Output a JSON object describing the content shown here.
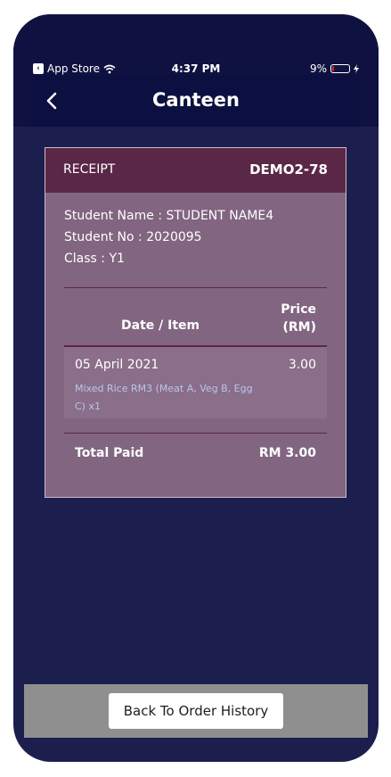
{
  "status_bar": {
    "back_app": "App Store",
    "time": "4:37 PM",
    "battery_percent": "9%",
    "battery_level": 0.09,
    "battery_color": "#e02020"
  },
  "nav": {
    "title": "Canteen",
    "back_icon": "chevron-left-icon"
  },
  "receipt": {
    "label": "RECEIPT",
    "number": "DEMO2-78",
    "student_name": "Student Name : STUDENT NAME4",
    "student_no": "Student No : 2020095",
    "class": "Class : Y1",
    "col_item": "Date / Item",
    "col_price_line1": "Price",
    "col_price_line2": "(RM)",
    "items": [
      {
        "date": "05 April 2021",
        "description": "Mixed Rice RM3 (Meat A, Veg B, Egg C) x1",
        "price": "3.00"
      }
    ],
    "total_label": "Total Paid",
    "total_value": "RM 3.00"
  },
  "footer": {
    "back_button": "Back To Order History"
  },
  "colors": {
    "background": "#1c1f4d",
    "header": "#0f1241",
    "card": "#826580",
    "card_header": "#5b2746",
    "item_description": "#b8c6ee"
  }
}
